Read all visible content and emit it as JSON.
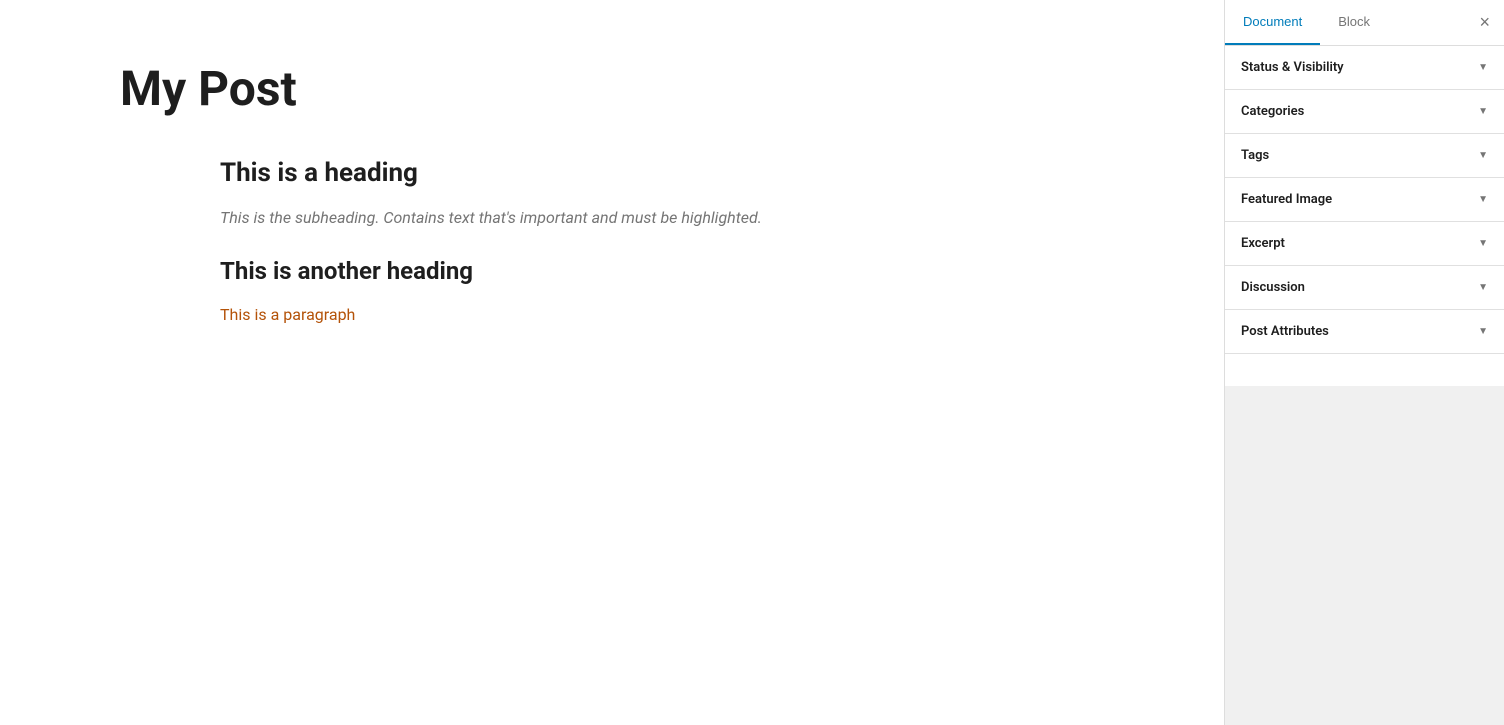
{
  "main": {
    "title": "My Post",
    "heading1": "This is a heading",
    "subheading": "This is the subheading. Contains text that's important and must be highlighted.",
    "heading2": "This is another heading",
    "paragraph": "This is a paragraph"
  },
  "sidebar": {
    "tabs": [
      {
        "id": "document",
        "label": "Document",
        "active": true
      },
      {
        "id": "block",
        "label": "Block",
        "active": false
      }
    ],
    "close_label": "×",
    "panels": [
      {
        "id": "status-visibility",
        "label": "Status & Visibility"
      },
      {
        "id": "categories",
        "label": "Categories"
      },
      {
        "id": "tags",
        "label": "Tags"
      },
      {
        "id": "featured-image",
        "label": "Featured Image"
      },
      {
        "id": "excerpt",
        "label": "Excerpt"
      },
      {
        "id": "discussion",
        "label": "Discussion"
      },
      {
        "id": "post-attributes",
        "label": "Post Attributes"
      }
    ]
  }
}
